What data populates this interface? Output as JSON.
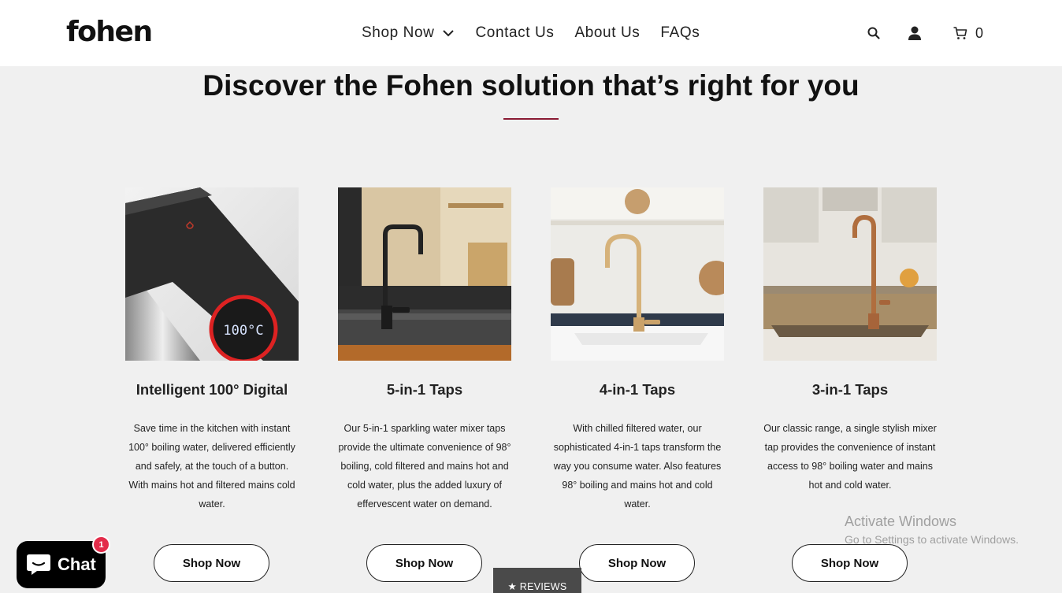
{
  "header": {
    "logo": "fohen",
    "nav": [
      {
        "label": "Shop Now"
      },
      {
        "label": "Contact Us"
      },
      {
        "label": "About Us"
      },
      {
        "label": "FAQs"
      }
    ],
    "cart_count": "0"
  },
  "hero": {
    "title": "Discover the Fohen solution that’s right for you",
    "accent_color": "#8a1a33"
  },
  "products": [
    {
      "title": "Intelligent 100° Digital",
      "description": "Save time in the kitchen with instant 100° boiling water, delivered efficiently and safely, at the touch of a button. With mains hot and filtered mains cold water.",
      "button": "Shop Now",
      "display_reading": "100°C"
    },
    {
      "title": "5-in-1 Taps",
      "description": "Our 5-in-1 sparkling water mixer taps provide the ultimate convenience of 98° boiling, cold filtered and mains hot and cold water, plus the added luxury of effervescent water on demand.",
      "button": "Shop Now"
    },
    {
      "title": "4-in-1 Taps",
      "description": "With chilled filtered water, our sophisticated 4-in-1 taps transform the way you consume water. Also features 98° boiling and mains hot and cold water.",
      "button": "Shop Now"
    },
    {
      "title": "3-in-1 Taps",
      "description": "Our classic range, a single stylish mixer tap provides the convenience of instant access to 98° boiling water and mains hot and cold water.",
      "button": "Shop Now"
    }
  ],
  "chat": {
    "label": "Chat",
    "badge": "1"
  },
  "reviews_tab": "★ REVIEWS",
  "os_watermark": {
    "line1": "Activate Windows",
    "line2": "Go to Settings to activate Windows."
  }
}
